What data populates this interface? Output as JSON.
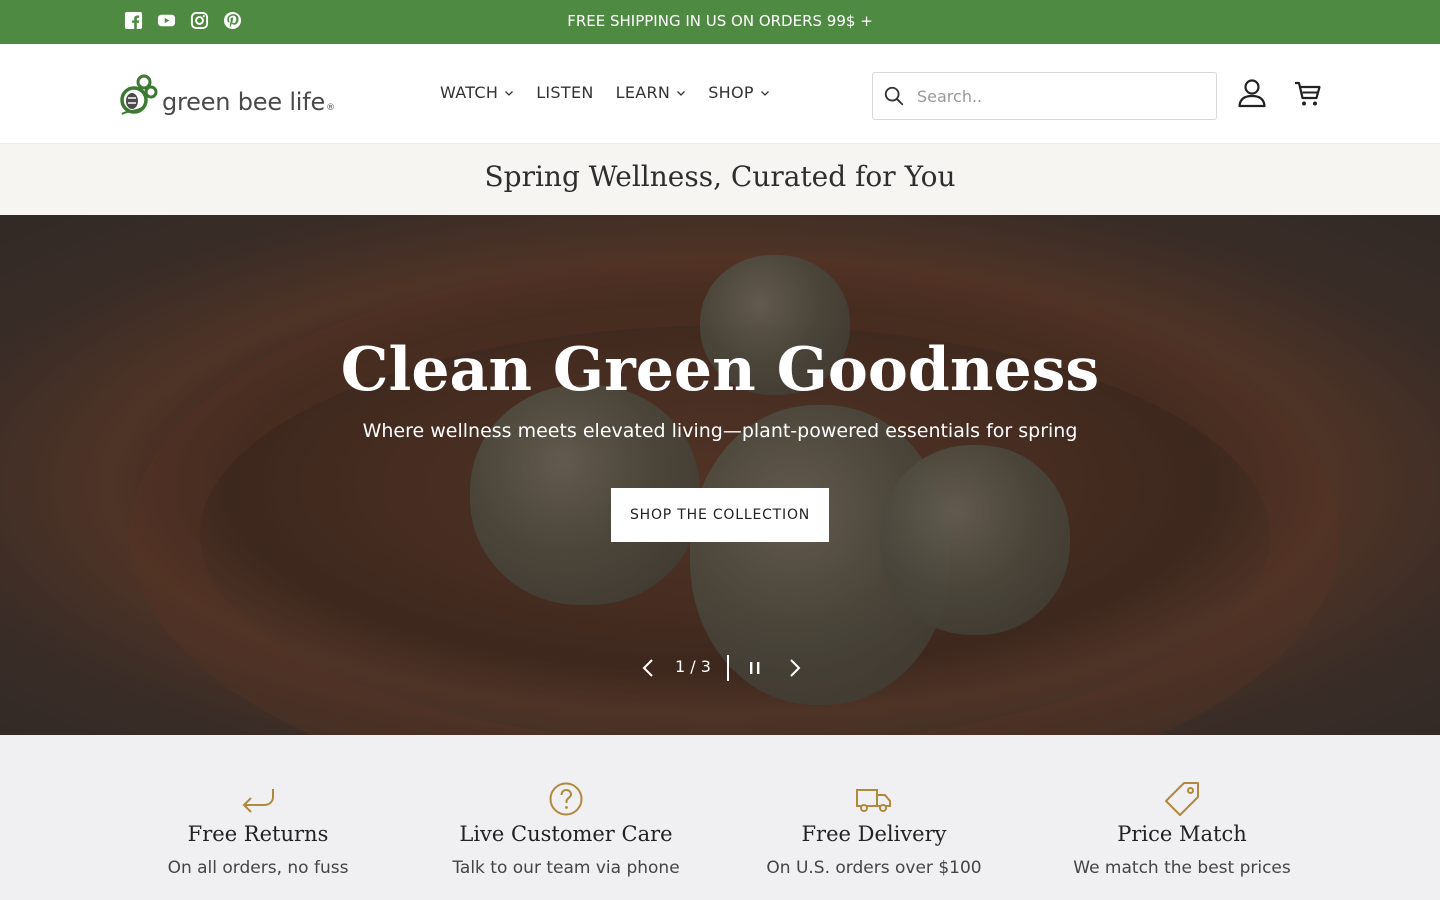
{
  "announcement": {
    "text": "FREE SHIPPING IN US ON ORDERS 99$ +",
    "background": "#4f8a43",
    "social_icons": [
      "facebook-icon",
      "youtube-icon",
      "instagram-icon",
      "pinterest-icon"
    ]
  },
  "header": {
    "logo_text": "green bee life",
    "logo_mark": "®",
    "nav": [
      {
        "label": "WATCH",
        "has_dropdown": true
      },
      {
        "label": "LISTEN",
        "has_dropdown": false
      },
      {
        "label": "LEARN",
        "has_dropdown": true
      },
      {
        "label": "SHOP",
        "has_dropdown": true
      }
    ],
    "search_placeholder": "Search..",
    "icons": [
      "search-icon",
      "account-icon",
      "cart-icon"
    ]
  },
  "promo": {
    "title": "Spring Wellness, Curated for You"
  },
  "hero": {
    "title": "Clean Green Goodness",
    "subtitle": "Where wellness meets elevated living—plant-powered essentials for spring",
    "button_label": "SHOP THE COLLECTION",
    "slide_counter": "1 / 3"
  },
  "features": [
    {
      "icon": "return-arrow-icon",
      "title": "Free Returns",
      "description": "On all orders, no fuss"
    },
    {
      "icon": "question-circle-icon",
      "title": "Live Customer Care",
      "description": "Talk to our team via phone"
    },
    {
      "icon": "truck-icon",
      "title": "Free Delivery",
      "description": "On U.S. orders over $100"
    },
    {
      "icon": "price-tag-icon",
      "title": "Price Match",
      "description": "We match the best prices"
    }
  ],
  "colors": {
    "brand_green": "#4f8a43",
    "accent_gold": "#b08a3c",
    "promo_bg": "#f6f5f1",
    "features_bg": "#f0eff2"
  }
}
